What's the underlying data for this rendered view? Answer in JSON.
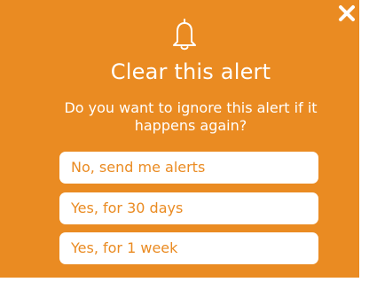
{
  "dialog": {
    "close_icon": "close-icon",
    "bell_icon": "bell-icon",
    "title": "Clear this alert",
    "question": "Do you want to ignore this alert if it happens again?",
    "options": [
      {
        "label": "No, send me alerts"
      },
      {
        "label": "Yes, for 30 days"
      },
      {
        "label": "Yes, for 1 week"
      }
    ]
  },
  "colors": {
    "accent": "#ea8b22",
    "text_on_accent": "#ffffff",
    "button_bg": "#ffffff"
  }
}
